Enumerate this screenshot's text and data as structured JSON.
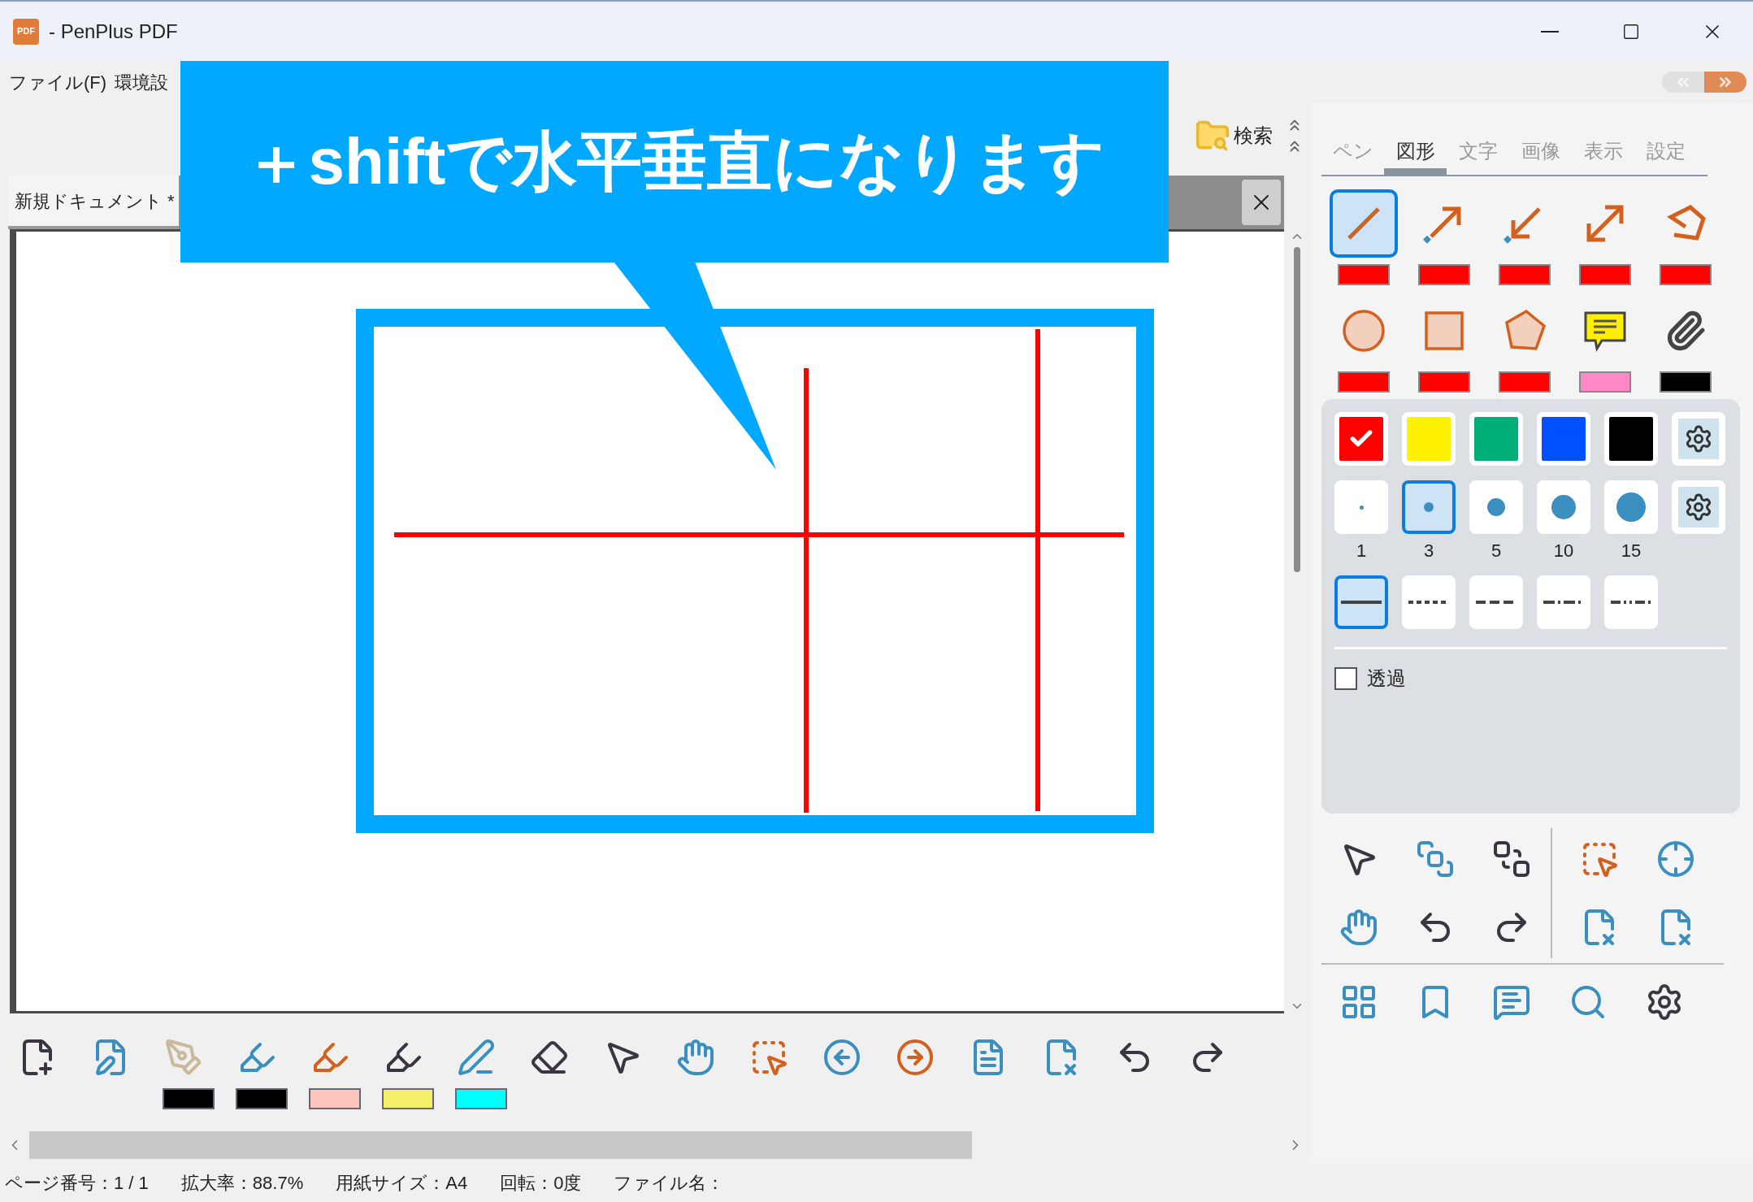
{
  "window": {
    "icon_label": "PDF",
    "title": "- PenPlus PDF"
  },
  "menu": [
    "ファイル(F)",
    "環境設"
  ],
  "page_nav": [
    {
      "kind": "first",
      "disabled": true
    },
    {
      "kind": "last",
      "disabled": false
    }
  ],
  "toolbar": {
    "search_button": "検索"
  },
  "document_tab": {
    "label": "新規ドキュメント *"
  },
  "callout": {
    "text": "＋shiftで水平垂直になります"
  },
  "panel_tabs": [
    {
      "label": "ペン",
      "selected": false
    },
    {
      "label": "図形",
      "selected": true
    },
    {
      "label": "文字",
      "selected": false
    },
    {
      "label": "画像",
      "selected": false
    },
    {
      "label": "表示",
      "selected": false
    },
    {
      "label": "設定",
      "selected": false
    }
  ],
  "shape_tools": [
    {
      "kind": "line",
      "selected": true,
      "color": "#ff0000"
    },
    {
      "kind": "arrow",
      "selected": false,
      "color": "#ff0000"
    },
    {
      "kind": "arrow_back",
      "selected": false,
      "color": "#ff0000"
    },
    {
      "kind": "double_arrow",
      "selected": false,
      "color": "#ff0000"
    },
    {
      "kind": "polyline",
      "selected": false,
      "color": "#ff0000"
    },
    {
      "kind": "ellipse",
      "selected": false,
      "color": "#ff0000"
    },
    {
      "kind": "rectangle",
      "selected": false,
      "color": "#ff0000"
    },
    {
      "kind": "polygon",
      "selected": false,
      "color": "#ff0000"
    },
    {
      "kind": "note",
      "selected": false,
      "color": "#ff88c8"
    },
    {
      "kind": "attachment",
      "selected": false,
      "color": "#000000"
    }
  ],
  "colors": [
    {
      "color": "#ff0000",
      "selected": true
    },
    {
      "color": "#fff200",
      "selected": false
    },
    {
      "color": "#00ae78",
      "selected": false
    },
    {
      "color": "#0050ff",
      "selected": false
    },
    {
      "color": "#000000",
      "selected": false
    }
  ],
  "widths": [
    {
      "label": "1",
      "selected": false
    },
    {
      "label": "3",
      "selected": true
    },
    {
      "label": "5",
      "selected": false
    },
    {
      "label": "10",
      "selected": false
    },
    {
      "label": "15",
      "selected": false
    }
  ],
  "dash_styles": [
    {
      "kind": "solid",
      "selected": true
    },
    {
      "kind": "dot",
      "selected": false
    },
    {
      "kind": "dash",
      "selected": false
    },
    {
      "kind": "dash_dot",
      "selected": false
    },
    {
      "kind": "dash_dot_dot",
      "selected": false
    }
  ],
  "transparent": {
    "label": "透過",
    "checked": false
  },
  "pen_swatches": [
    {
      "color": "#000000"
    },
    {
      "color": "#000000"
    },
    {
      "color": "#ffc4bc"
    },
    {
      "color": "#f4f06a"
    },
    {
      "color": "#00ffff"
    }
  ],
  "status_bar": [
    "ページ番号：1 / 1",
    "拡大率：88.7%",
    "用紙サイズ：A4",
    "回転：0度",
    "ファイル名："
  ]
}
